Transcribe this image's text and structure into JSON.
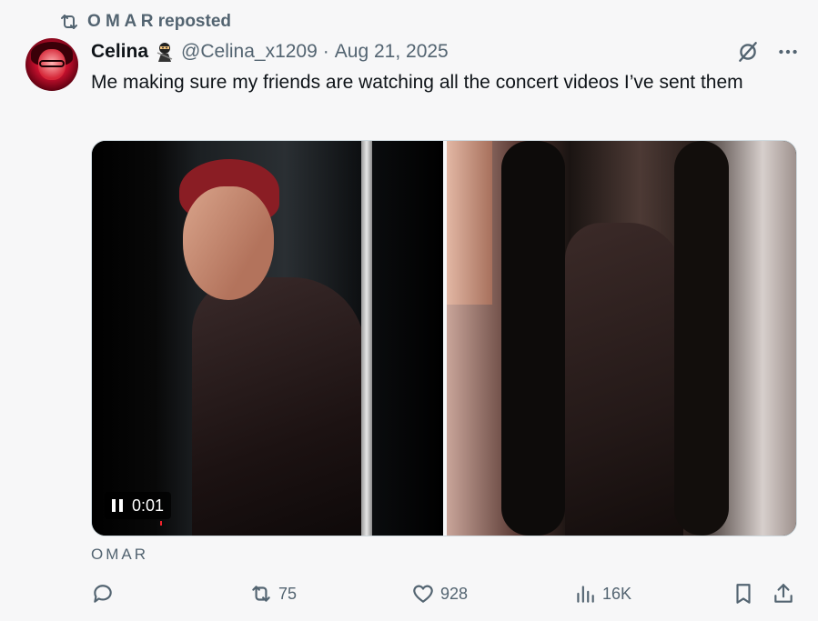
{
  "repost": {
    "label": "O M A R reposted",
    "icon": "repost-icon"
  },
  "author": {
    "name": "Celina",
    "emoji": "ninja-emoji",
    "handle": "@Celina_x1209",
    "separator": "·",
    "date": "Aug 21, 2025"
  },
  "tweet": {
    "text": "Me making sure my friends are watching all the concert videos I’ve sent them"
  },
  "video": {
    "time": "0:01",
    "state": "playing"
  },
  "caption": "OMAR",
  "actions": {
    "replies": "",
    "reposts": "75",
    "likes": "928",
    "views": "16K"
  },
  "colors": {
    "muted": "#536471",
    "text": "#0f1419",
    "bg": "#f7f7f8"
  }
}
